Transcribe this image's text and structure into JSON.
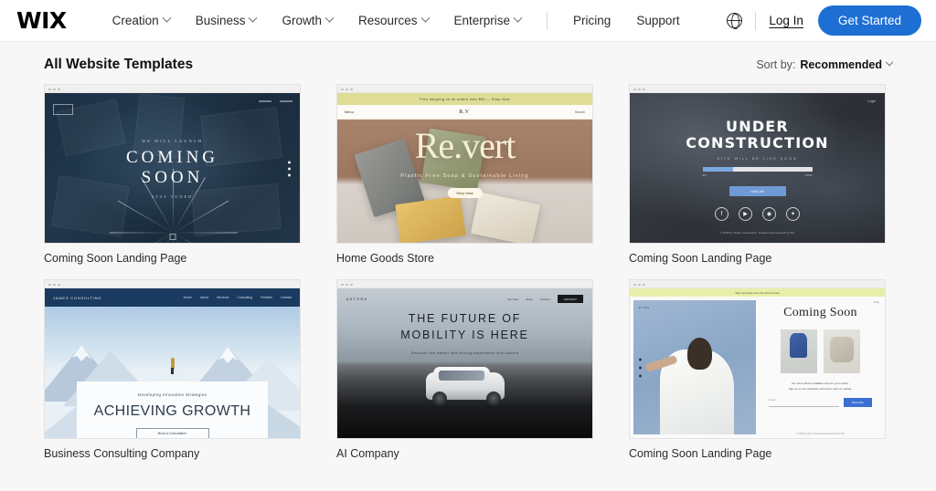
{
  "header": {
    "logo": "WIX",
    "nav": [
      {
        "label": "Creation",
        "has_dropdown": true
      },
      {
        "label": "Business",
        "has_dropdown": true
      },
      {
        "label": "Growth",
        "has_dropdown": true
      },
      {
        "label": "Resources",
        "has_dropdown": true
      },
      {
        "label": "Enterprise",
        "has_dropdown": true
      }
    ],
    "nav_plain": [
      {
        "label": "Pricing"
      },
      {
        "label": "Support"
      }
    ],
    "language_icon": "globe-icon",
    "login_label": "Log In",
    "cta_label": "Get Started",
    "cta_color": "#1d6fd4"
  },
  "toolbar": {
    "page_title": "All Website Templates",
    "sort_prefix": "Sort by:",
    "sort_value": "Recommended",
    "sort_icon": "chevron-down-icon"
  },
  "templates": [
    {
      "caption": "Coming Soon Landing Page",
      "preview": {
        "kicker": "WE WILL LAUNCH",
        "title_line1": "COMING",
        "title_line2": "SOON",
        "subtitle": "STAY TUNED",
        "theme_color": "#1d3146"
      }
    },
    {
      "caption": "Home Goods Store",
      "preview": {
        "announcement": "Free shipping on all orders over $50 — Shop Now",
        "nav_left": "Menu",
        "brand": "R.V",
        "nav_right": "Search",
        "headline": "Re.vert",
        "tagline": "Plastic Free Soap & Sustainable Living",
        "button": "Shop Now",
        "theme_color": "#a8836c"
      }
    },
    {
      "caption": "Coming Soon Landing Page",
      "preview": {
        "top_link": "Login",
        "title_line1": "UNDER",
        "title_line2": "CONSTRUCTION",
        "subtitle": "SITE WILL BE LIVE SOON",
        "progress_percent": 28,
        "progress_start": "0%",
        "progress_end": "100%",
        "button": "Notify Me",
        "socials": [
          "facebook-icon",
          "youtube-icon",
          "instagram-icon",
          "twitter-icon"
        ],
        "footer": "© 2035 by Under Construction. Powered and secured by Wix",
        "theme_color": "#2f3339"
      }
    },
    {
      "caption": "Business Consulting Company",
      "preview": {
        "brand": "JAMES CONSULTING",
        "nav": [
          "Home",
          "About",
          "Services",
          "Consulting",
          "Portfolio",
          "Contact"
        ],
        "kicker": "Developing Innovative Strategies",
        "title": "ACHIEVING GROWTH",
        "button": "Book A Consultation",
        "theme_color": "#1b3a5f"
      }
    },
    {
      "caption": "AI Company",
      "preview": {
        "brand": "ASTORA",
        "nav": [
          "Our Tech",
          "About",
          "Careers"
        ],
        "nav_cta": "CONTACT",
        "title_line1": "THE FUTURE OF",
        "title_line2": "MOBILITY IS HERE",
        "subtitle": "Discover the safest self-driving experience with Astora",
        "theme_color": "#8d979f"
      }
    },
    {
      "caption": "Coming Soon Landing Page",
      "preview": {
        "announcement": "Sign up below to be the first to know",
        "left_label": "ETNA",
        "top_link": "Shop",
        "title": "Coming Soon",
        "note_line1": "Our store will be available soon for your orders.",
        "note_line2": "Sign up to our newsletter and never miss an update.",
        "input_placeholder": "Email",
        "submit": "Subscribe",
        "footer": "© 2035 by Etna. Powered and secured by Wix",
        "theme_color": "#8aa6c6"
      }
    }
  ]
}
